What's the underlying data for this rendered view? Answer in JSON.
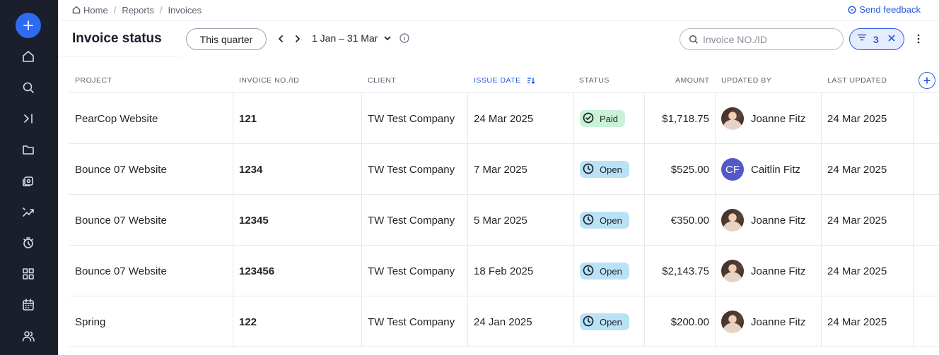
{
  "breadcrumb": {
    "items": [
      "Home",
      "Reports",
      "Invoices"
    ]
  },
  "feedback": {
    "label": "Send feedback"
  },
  "toolbar": {
    "title": "Invoice status",
    "period_button": "This quarter",
    "date_range": "1 Jan – 31 Mar",
    "search_placeholder": "Invoice NO./ID",
    "filter_count": "3"
  },
  "sidebar": {
    "icons": [
      "plus-icon",
      "home-icon",
      "search-icon",
      "collapse-icon",
      "folder-icon",
      "portfolio-icon",
      "insights-icon",
      "timer-icon",
      "apps-icon",
      "calendar-icon",
      "people-icon"
    ]
  },
  "table": {
    "columns": {
      "project": "PROJECT",
      "invoice": "INVOICE NO./ID",
      "client": "CLIENT",
      "issue_date": "ISSUE DATE",
      "status": "STATUS",
      "amount": "AMOUNT",
      "updated_by": "UPDATED BY",
      "last_updated": "LAST UPDATED"
    },
    "rows": [
      {
        "project": "PearCop Website",
        "invoice": "121",
        "client": "TW Test Company",
        "issue_date": "24 Mar 2025",
        "status": "Paid",
        "amount": "$1,718.75",
        "updated_by": "Joanne Fitz",
        "avatar": "photo",
        "initials": "",
        "last_updated": "24 Mar 2025"
      },
      {
        "project": "Bounce 07 Website",
        "invoice": "1234",
        "client": "TW Test Company",
        "issue_date": "7 Mar 2025",
        "status": "Open",
        "amount": "$525.00",
        "updated_by": "Caitlin Fitz",
        "avatar": "initials",
        "initials": "CF",
        "last_updated": "24 Mar 2025"
      },
      {
        "project": "Bounce 07 Website",
        "invoice": "12345",
        "client": "TW Test Company",
        "issue_date": "5 Mar 2025",
        "status": "Open",
        "amount": "€350.00",
        "updated_by": "Joanne Fitz",
        "avatar": "photo",
        "initials": "",
        "last_updated": "24 Mar 2025"
      },
      {
        "project": "Bounce 07 Website",
        "invoice": "123456",
        "client": "TW Test Company",
        "issue_date": "18 Feb 2025",
        "status": "Open",
        "amount": "$2,143.75",
        "updated_by": "Joanne Fitz",
        "avatar": "photo",
        "initials": "",
        "last_updated": "24 Mar 2025"
      },
      {
        "project": "Spring",
        "invoice": "122",
        "client": "TW Test Company",
        "issue_date": "24 Jan 2025",
        "status": "Open",
        "amount": "$200.00",
        "updated_by": "Joanne Fitz",
        "avatar": "photo",
        "initials": "",
        "last_updated": "24 Mar 2025"
      }
    ]
  },
  "colors": {
    "sidebar": "#1b1f2b",
    "accent": "#2d5ae0",
    "paid": "#c9f2d9",
    "open": "#b9e2f7"
  }
}
